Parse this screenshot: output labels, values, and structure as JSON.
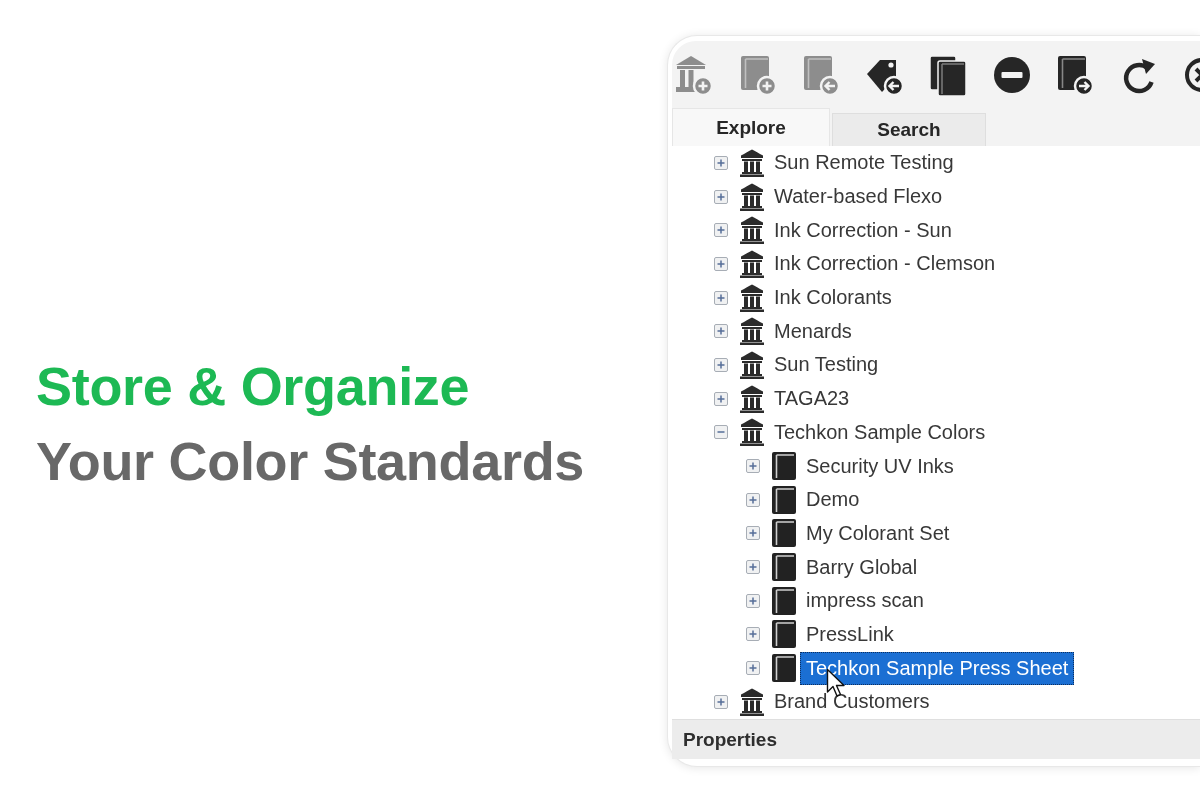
{
  "headline": {
    "line_1": "Store & Organize",
    "line_2": "Your Color Standards"
  },
  "toolbar": [
    {
      "kind": "library-add",
      "disabled": true
    },
    {
      "kind": "book-add",
      "disabled": true
    },
    {
      "kind": "book-import",
      "disabled": true
    },
    {
      "kind": "tag-import",
      "disabled": false
    },
    {
      "kind": "books",
      "disabled": false
    },
    {
      "kind": "remove",
      "disabled": false
    },
    {
      "kind": "book-export",
      "disabled": false
    },
    {
      "kind": "refresh",
      "disabled": false
    },
    {
      "kind": "close",
      "disabled": false
    }
  ],
  "tabs": [
    {
      "label": "Explore",
      "selected": true
    },
    {
      "label": "Search",
      "selected": false
    }
  ],
  "tree": [
    {
      "kind": "library",
      "label": "Sun Remote Testing",
      "expanded": false,
      "selected": false
    },
    {
      "kind": "library",
      "label": "Water-based Flexo",
      "expanded": false,
      "selected": false
    },
    {
      "kind": "library",
      "label": "Ink Correction - Sun",
      "expanded": false,
      "selected": false
    },
    {
      "kind": "library",
      "label": "Ink Correction - Clemson",
      "expanded": false,
      "selected": false
    },
    {
      "kind": "library",
      "label": "Ink Colorants",
      "expanded": false,
      "selected": false
    },
    {
      "kind": "library",
      "label": "Menards",
      "expanded": false,
      "selected": false
    },
    {
      "kind": "library",
      "label": "Sun Testing",
      "expanded": false,
      "selected": false
    },
    {
      "kind": "library",
      "label": "TAGA23",
      "expanded": false,
      "selected": false
    },
    {
      "kind": "library",
      "label": "Techkon Sample Colors",
      "expanded": true,
      "selected": false,
      "children": [
        {
          "kind": "book",
          "label": "Security UV Inks",
          "expanded": false,
          "selected": false
        },
        {
          "kind": "book",
          "label": "Demo",
          "expanded": false,
          "selected": false
        },
        {
          "kind": "book",
          "label": "My Colorant Set",
          "expanded": false,
          "selected": false
        },
        {
          "kind": "book",
          "label": "Barry Global",
          "expanded": false,
          "selected": false
        },
        {
          "kind": "book",
          "label": "impress scan",
          "expanded": false,
          "selected": false
        },
        {
          "kind": "book",
          "label": "PressLink",
          "expanded": false,
          "selected": false
        },
        {
          "kind": "book",
          "label": "Techkon Sample Press Sheet",
          "expanded": false,
          "selected": true
        }
      ]
    },
    {
      "kind": "library",
      "label": "Brand Customers",
      "expanded": false,
      "selected": false
    }
  ],
  "properties": {
    "title": "Properties"
  }
}
